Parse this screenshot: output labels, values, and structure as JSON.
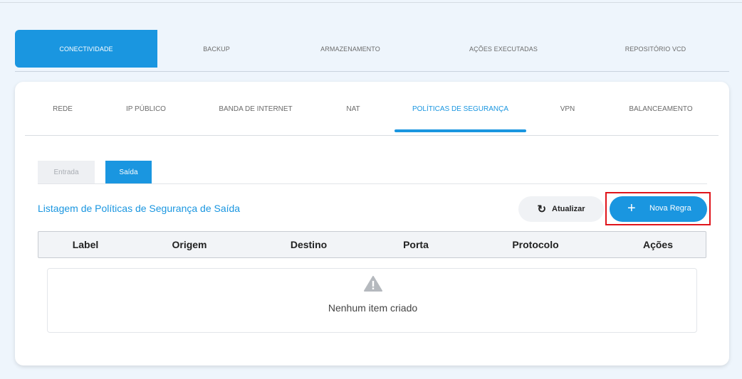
{
  "top_tabs": [
    "CONECTIVIDADE",
    "BACKUP",
    "ARMAZENAMENTO",
    "AÇÕES EXECUTADAS",
    "REPOSITÓRIO VCD"
  ],
  "sub_tabs": [
    "REDE",
    "IP PÚBLICO",
    "BANDA DE INTERNET",
    "NAT",
    "POLÍTICAS DE SEGURANÇA",
    "VPN",
    "BALANCEAMENTO"
  ],
  "direction_tabs": [
    "Entrada",
    "Saída"
  ],
  "list_title": "Listagem de Políticas de Segurança de Saída",
  "buttons": {
    "refresh_label": "Atualizar",
    "new_rule_label": "Nova Regra"
  },
  "table": {
    "columns": [
      "Label",
      "Origem",
      "Destino",
      "Porta",
      "Protocolo",
      "Ações"
    ],
    "empty_message": "Nenhum item criado"
  },
  "icons": {
    "refresh": "refresh-icon",
    "plus": "plus-icon",
    "warning": "warning-icon"
  },
  "colors": {
    "accent": "#1a96e0",
    "highlight": "#e0141b"
  }
}
